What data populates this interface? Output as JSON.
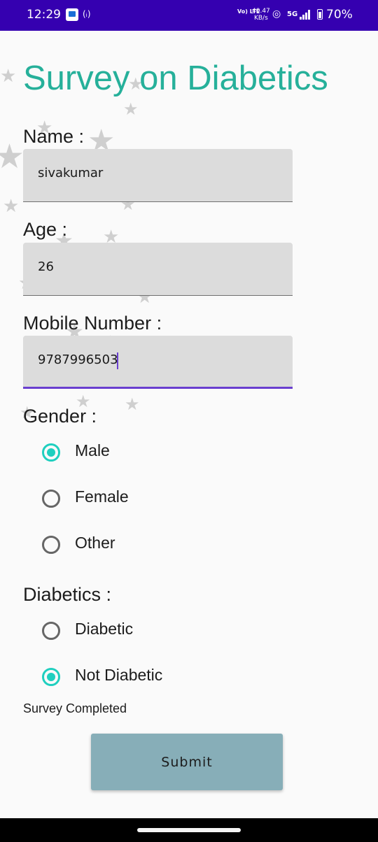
{
  "status_bar": {
    "time": "12:29",
    "cast_icon": "(ᵢ)",
    "lte_label": "Vo) LTE",
    "speed_value": "40.47",
    "speed_unit": "KB/s",
    "network": "5G",
    "battery_percent": "70%",
    "icons": [
      "app-notification-icon",
      "cast-icon",
      "hotspot-icon",
      "signal-icon",
      "battery-icon"
    ]
  },
  "form": {
    "title": "Survey on Diabetics",
    "name_label": "Name :",
    "name_value": "sivakumar",
    "age_label": "Age :",
    "age_value": "26",
    "mobile_label": "Mobile Number :",
    "mobile_value": "9787996503",
    "gender_label": "Gender :",
    "gender_options": [
      {
        "label": "Male",
        "checked": true
      },
      {
        "label": "Female",
        "checked": false
      },
      {
        "label": "Other",
        "checked": false
      }
    ],
    "diabetics_label": "Diabetics :",
    "diabetics_options": [
      {
        "label": "Diabetic",
        "checked": false
      },
      {
        "label": "Not Diabetic",
        "checked": true
      }
    ],
    "status_text": "Survey Completed",
    "submit_label": "Submit"
  },
  "colors": {
    "status_bar": "#3500b0",
    "title": "#26b09a",
    "accent_radio": "#1fcfbf",
    "focus_underline": "#6a3fd0",
    "submit_button": "#87aeb8"
  }
}
